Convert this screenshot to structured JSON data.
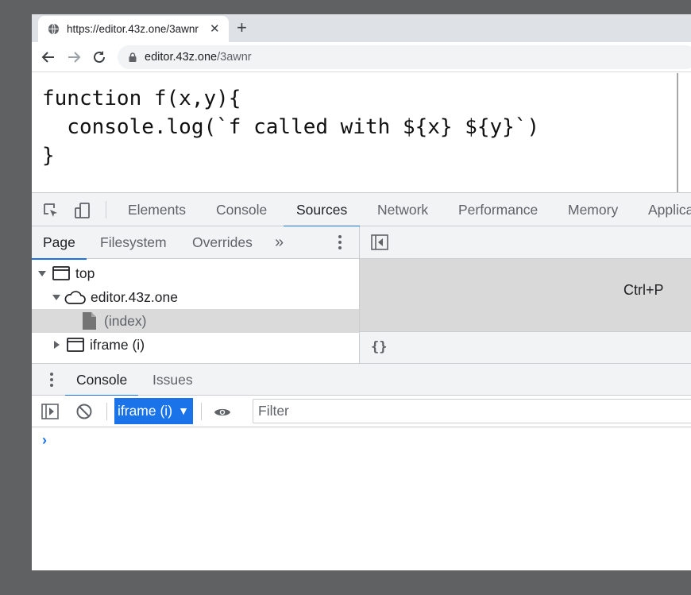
{
  "browser": {
    "tab": {
      "title": "https://editor.43z.one/3awnr",
      "close_glyph": "✕"
    },
    "new_tab_glyph": "+",
    "address": {
      "host": "editor.43z.one",
      "path": "/3awnr"
    }
  },
  "page": {
    "code_lines": [
      "function f(x,y){",
      "  console.log(`f called with ${x} ${y}`)",
      "}"
    ]
  },
  "devtools": {
    "tabs": [
      "Elements",
      "Console",
      "Sources",
      "Network",
      "Performance",
      "Memory",
      "Applica"
    ],
    "active_tab": "Sources",
    "sources": {
      "nav_tabs": [
        "Page",
        "Filesystem",
        "Overrides"
      ],
      "more_glyph": "»",
      "tree": [
        {
          "label": "top"
        },
        {
          "label": "editor.43z.one"
        },
        {
          "label": "(index)"
        },
        {
          "label": "iframe (i)"
        }
      ],
      "editor_hint": "Ctrl+P",
      "pretty_print": "{}"
    },
    "drawer": {
      "tabs": [
        "Console",
        "Issues"
      ]
    },
    "console": {
      "context": "iframe (i)",
      "filter_placeholder": "Filter",
      "prompt": "›"
    }
  },
  "colors": {
    "accent": "#1a73e8",
    "panel_bg": "#f1f3f4",
    "selected_row": "#dadada",
    "frame_bg": "#5f6163"
  }
}
